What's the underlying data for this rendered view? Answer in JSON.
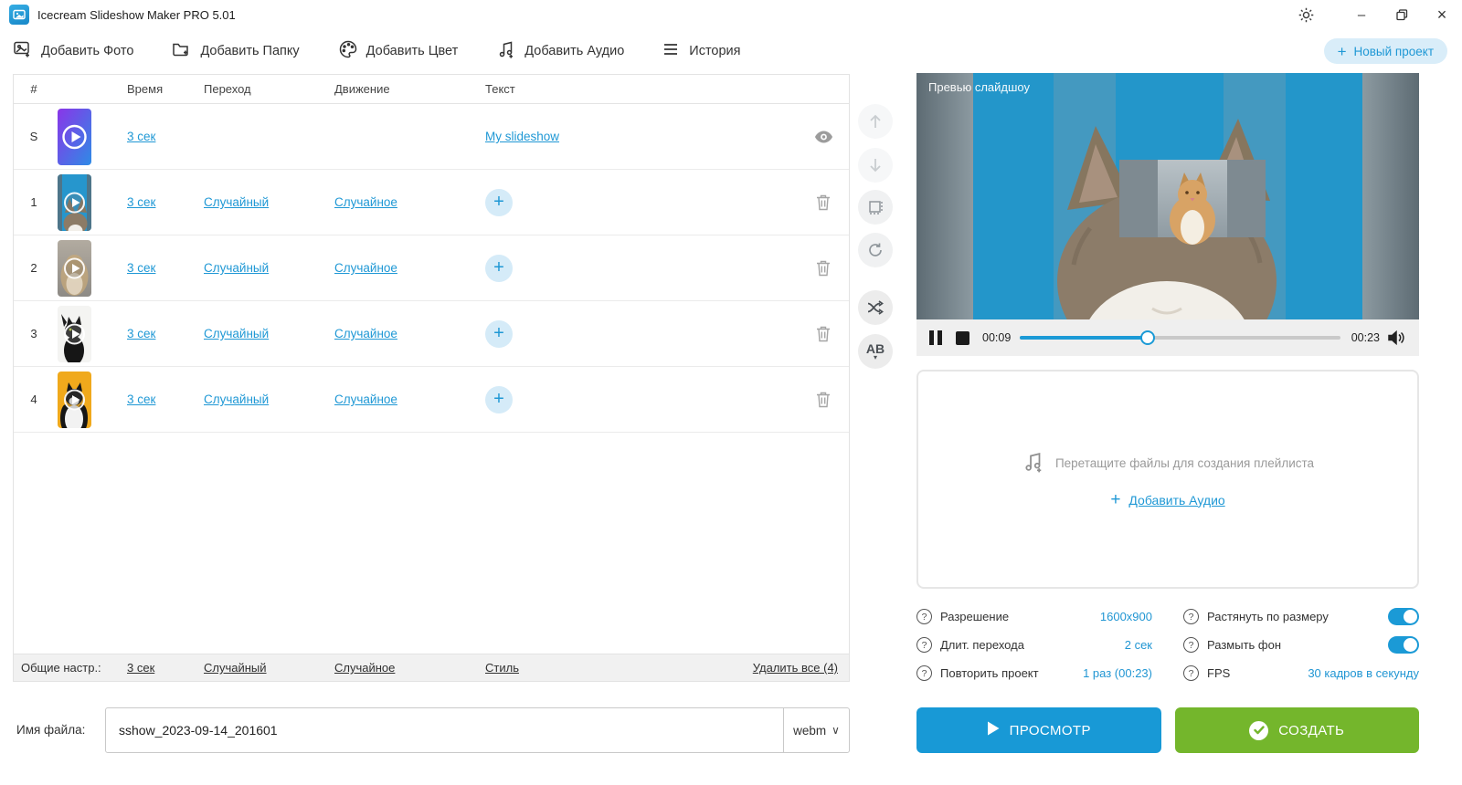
{
  "window": {
    "title": "Icecream Slideshow Maker PRO 5.01",
    "minimize_glyph": "–",
    "close_glyph": "×"
  },
  "toolbar": {
    "add_photo": "Добавить Фото",
    "add_folder": "Добавить Папку",
    "add_color": "Добавить Цвет",
    "add_audio": "Добавить Аудио",
    "history": "История",
    "new_project": "Новый проект"
  },
  "icons": {
    "plus": "+",
    "chevron_down": "∨",
    "ab": "AB",
    "caret_down": "▾"
  },
  "table": {
    "headers": {
      "num": "#",
      "time": "Время",
      "transition": "Переход",
      "motion": "Движение",
      "text": "Текст"
    },
    "slides": [
      {
        "num": "S",
        "duration": "3 сек",
        "text": "My slideshow"
      },
      {
        "num": "1",
        "duration": "3 сек",
        "transition": "Случайный",
        "motion": "Случайное"
      },
      {
        "num": "2",
        "duration": "3 сек",
        "transition": "Случайный",
        "motion": "Случайное"
      },
      {
        "num": "3",
        "duration": "3 сек",
        "transition": "Случайный",
        "motion": "Случайное"
      },
      {
        "num": "4",
        "duration": "3 сек",
        "transition": "Случайный",
        "motion": "Случайное"
      }
    ],
    "footer": {
      "label": "Общие настр.:",
      "duration": "3 сек",
      "transition": "Случайный",
      "motion": "Случайное",
      "style": "Стиль",
      "delete_all": "Удалить все (4)"
    }
  },
  "filename": {
    "label": "Имя файла:",
    "value": "sshow_2023-09-14_201601",
    "format": "webm"
  },
  "preview": {
    "title": "Превью слайдшоу",
    "current_time": "00:09",
    "total_time": "00:23",
    "progress_percent": 40
  },
  "audio": {
    "dropzone_text": "Перетащите файлы для создания плейлиста",
    "add_audio_label": "Добавить Аудио"
  },
  "settings": {
    "left": [
      {
        "label": "Разрешение",
        "value": "1600x900"
      },
      {
        "label": "Длит. перехода",
        "value": "2 сек"
      },
      {
        "label": "Повторить проект",
        "value": "1 раз (00:23)"
      }
    ],
    "right": [
      {
        "label": "Растянуть по размеру",
        "toggle": "on"
      },
      {
        "label": "Размыть фон",
        "toggle": "on"
      },
      {
        "label": "FPS",
        "value": "30 кадров в секунду"
      }
    ]
  },
  "actions": {
    "preview": "ПРОСМОТР",
    "create": "СОЗДАТЬ"
  },
  "colors": {
    "accent": "#1f98d5",
    "green": "#74b62c"
  }
}
